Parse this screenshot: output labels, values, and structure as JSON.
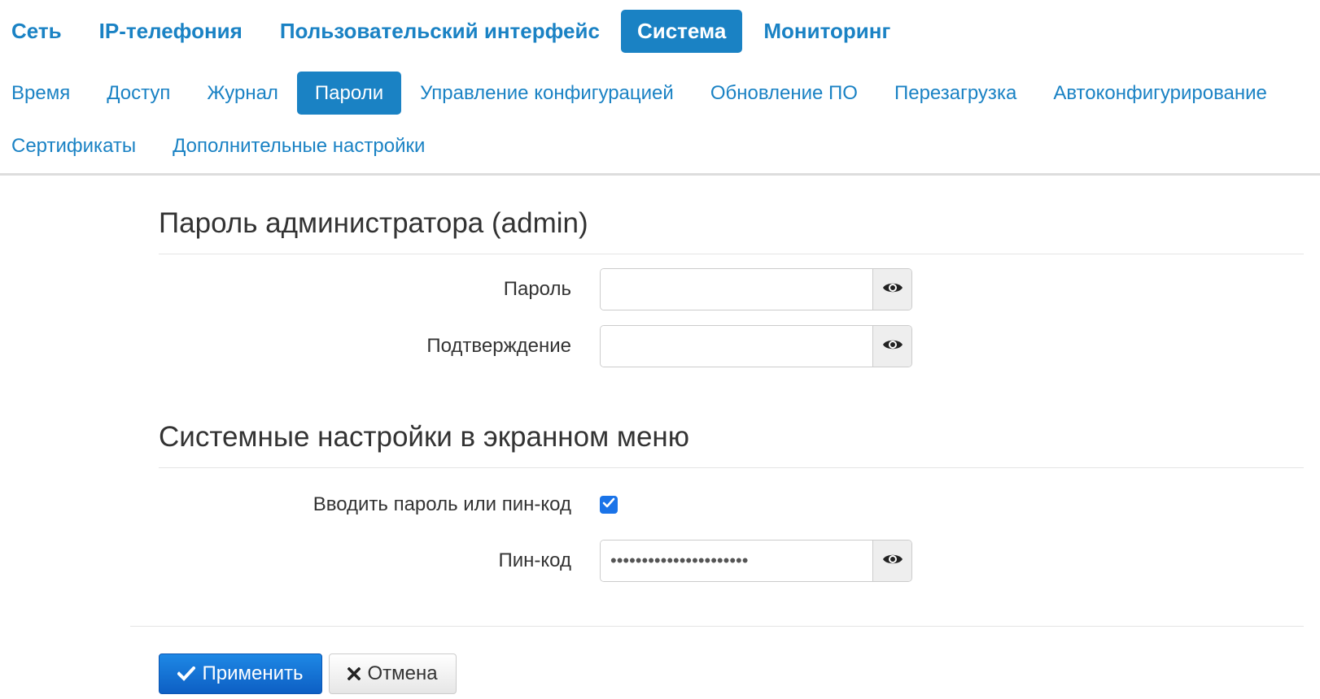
{
  "nav_main": [
    {
      "label": "Сеть",
      "active": false
    },
    {
      "label": "IP-телефония",
      "active": false
    },
    {
      "label": "Пользовательский интерфейс",
      "active": false
    },
    {
      "label": "Система",
      "active": true
    },
    {
      "label": "Мониторинг",
      "active": false
    }
  ],
  "nav_sub": [
    {
      "label": "Время",
      "active": false
    },
    {
      "label": "Доступ",
      "active": false
    },
    {
      "label": "Журнал",
      "active": false
    },
    {
      "label": "Пароли",
      "active": true
    },
    {
      "label": "Управление конфигурацией",
      "active": false
    },
    {
      "label": "Обновление ПО",
      "active": false
    },
    {
      "label": "Перезагрузка",
      "active": false
    },
    {
      "label": "Автоконфигурирование",
      "active": false
    },
    {
      "label": "Сертификаты",
      "active": false
    },
    {
      "label": "Дополнительные настройки",
      "active": false
    }
  ],
  "admin_section": {
    "title": "Пароль администратора (admin)",
    "password_label": "Пароль",
    "password_value": "",
    "confirm_label": "Подтверждение",
    "confirm_value": ""
  },
  "osd_section": {
    "title": "Системные настройки в экранном меню",
    "require_pin_label": "Вводить пароль или пин-код",
    "require_pin_checked": true,
    "pin_label": "Пин-код",
    "pin_value": "••••••••••••••••••••••"
  },
  "buttons": {
    "apply_label": "Применить",
    "cancel_label": "Отмена"
  },
  "icons": {
    "eye": "eye-icon",
    "check": "check-icon",
    "times": "times-icon",
    "checkbox_mark": "checkmark-icon"
  },
  "colors": {
    "accent": "#1a82c4",
    "primary_button": "#1565d8",
    "checkbox": "#1a73e8"
  }
}
